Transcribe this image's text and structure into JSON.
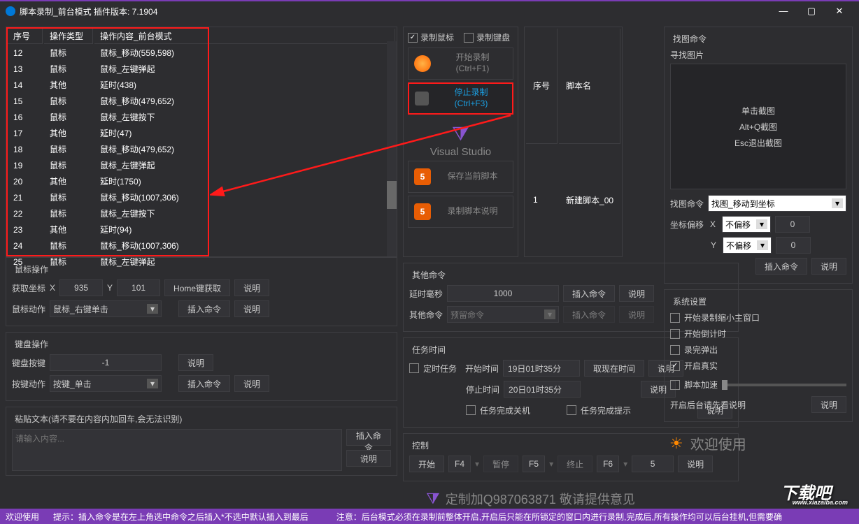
{
  "window": {
    "title": "脚本录制_前台模式  插件版本: 7.1904"
  },
  "action_table": {
    "headers": {
      "c1": "序号",
      "c2": "操作类型",
      "c3": "操作内容_前台模式"
    },
    "rows": [
      {
        "n": "12",
        "type": "鼠标",
        "content": "鼠标_移动(559,598)"
      },
      {
        "n": "13",
        "type": "鼠标",
        "content": "鼠标_左键弹起"
      },
      {
        "n": "14",
        "type": "其他",
        "content": "延时(438)"
      },
      {
        "n": "15",
        "type": "鼠标",
        "content": "鼠标_移动(479,652)"
      },
      {
        "n": "16",
        "type": "鼠标",
        "content": "鼠标_左键按下"
      },
      {
        "n": "17",
        "type": "其他",
        "content": "延时(47)"
      },
      {
        "n": "18",
        "type": "鼠标",
        "content": "鼠标_移动(479,652)"
      },
      {
        "n": "19",
        "type": "鼠标",
        "content": "鼠标_左键弹起"
      },
      {
        "n": "20",
        "type": "其他",
        "content": "延时(1750)"
      },
      {
        "n": "21",
        "type": "鼠标",
        "content": "鼠标_移动(1007,306)"
      },
      {
        "n": "22",
        "type": "鼠标",
        "content": "鼠标_左键按下"
      },
      {
        "n": "23",
        "type": "其他",
        "content": "延时(94)"
      },
      {
        "n": "24",
        "type": "鼠标",
        "content": "鼠标_移动(1007,306)"
      },
      {
        "n": "25",
        "type": "鼠标",
        "content": "鼠标_左键弹起"
      }
    ]
  },
  "mouse_ops": {
    "title": "鼠标操作",
    "get_coord": "获取坐标",
    "x_label": "X",
    "x_val": "935",
    "y_label": "Y",
    "y_val": "101",
    "home_btn": "Home键获取",
    "explain": "说明",
    "action_label": "鼠标动作",
    "action_val": "鼠标_右键单击",
    "insert": "插入命令"
  },
  "kb_ops": {
    "title": "键盘操作",
    "key_label": "键盘按键",
    "key_val": "-1",
    "action_label": "按键动作",
    "action_val": "按键_单击",
    "insert": "插入命令",
    "explain": "说明"
  },
  "paste": {
    "title": "粘贴文本(请不要在内容内加回车,会无法识别)",
    "placeholder": "请输入内容...",
    "insert": "插入命令",
    "explain": "说明"
  },
  "rec": {
    "mouse": "录制鼠标",
    "keyboard": "录制键盘",
    "start": "开始录制",
    "start_key": "(Ctrl+F1)",
    "stop": "停止录制",
    "stop_key": "(Ctrl+F3)",
    "vs": "Visual Studio",
    "save": "保存当前脚本",
    "help": "录制脚本说明"
  },
  "scripts": {
    "h1": "序号",
    "h2": "脚本名",
    "row1_n": "1",
    "row1_name": "新建脚本_00"
  },
  "other": {
    "title": "其他命令",
    "delay_label": "延时毫秒",
    "delay_val": "1000",
    "insert": "插入命令",
    "explain": "说明",
    "cmd_label": "其他命令",
    "cmd_ph": "预留命令"
  },
  "task": {
    "title": "任务时间",
    "timed": "定时任务",
    "start_label": "开始时间",
    "start_val": "19日01时35分",
    "get_now": "取现在时间",
    "explain": "说明",
    "stop_label": "停止时间",
    "stop_val": "20日01时35分",
    "shutdown": "任务完成关机",
    "notify": "任务完成提示"
  },
  "control": {
    "title": "控制",
    "start": "开始",
    "f4": "F4",
    "pause": "暂停",
    "f5": "F5",
    "stop": "终止",
    "f6": "F6",
    "count": "5",
    "explain": "说明"
  },
  "img_cmd": {
    "title": "找图命令",
    "find_label": "寻找图片",
    "capture1": "单击截图",
    "capture2": "Alt+Q截图",
    "capture3": "Esc退出截图",
    "cmd_label": "找图命令",
    "cmd_val": "找图_移动到坐标",
    "offset_label": "坐标偏移",
    "x": "X",
    "x_val": "不偏移",
    "x_num": "0",
    "y": "Y",
    "y_val": "不偏移",
    "y_num": "0",
    "insert": "插入命令",
    "explain": "说明"
  },
  "sys": {
    "title": "系统设置",
    "s1": "开始录制缩小主窗口",
    "s2": "开始倒计时",
    "s3": "录完弹出",
    "s4": "开启真实",
    "accel": "脚本加速",
    "bg_note": "开启后台请先看说明",
    "explain": "说明"
  },
  "welcome": "欢迎使用",
  "qtext": "定制加Q987063871  敬请提供意见",
  "footer": {
    "p1": "欢迎使用",
    "p2": "提示：插入命令是在左上角选中命令之后插入*不选中默认插入到最后",
    "p3": "注意：后台模式必须在录制前整体开启,开启后只能在所锁定的窗口内进行录制,完成后,所有操作均可以后台挂机,但需要确"
  },
  "dlogo": {
    "main": "下载吧",
    "sub": "www.xiazaiba.com"
  }
}
